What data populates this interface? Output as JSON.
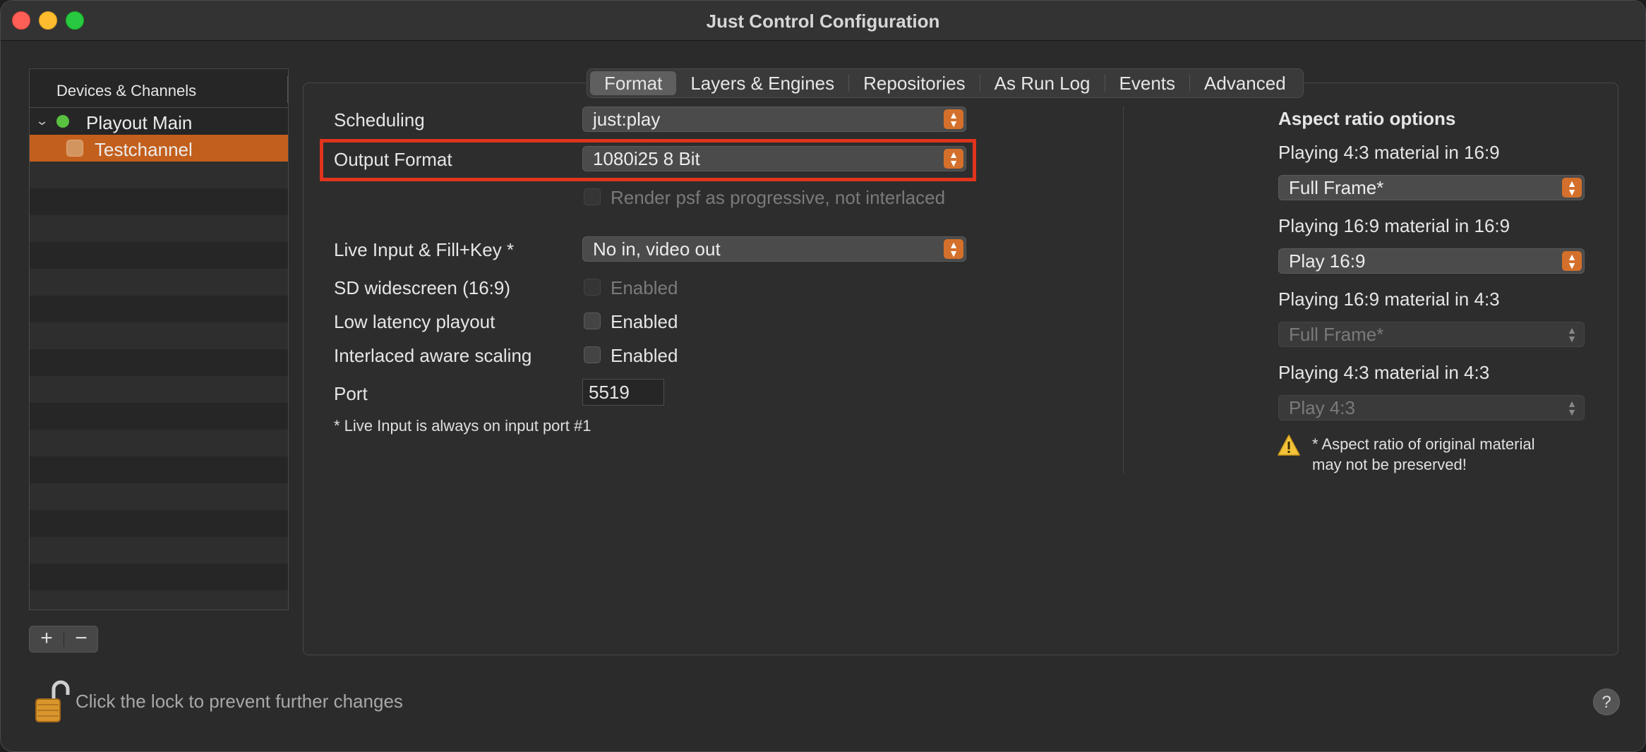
{
  "window": {
    "title": "Just Control Configuration"
  },
  "sidebar": {
    "header": "Devices & Channels",
    "device": {
      "label": "Playout Main"
    },
    "channel": {
      "label": "Testchannel"
    }
  },
  "sidebar_buttons": {
    "add": "+",
    "remove": "−"
  },
  "tabs": [
    {
      "label": "Format"
    },
    {
      "label": "Layers & Engines"
    },
    {
      "label": "Repositories"
    },
    {
      "label": "As Run Log"
    },
    {
      "label": "Events"
    },
    {
      "label": "Advanced"
    }
  ],
  "format": {
    "scheduling": {
      "label": "Scheduling",
      "value": "just:play"
    },
    "output_format": {
      "label": "Output Format",
      "value": "1080i25 8 Bit"
    },
    "render_psf": {
      "label": "Render psf as progressive, not interlaced"
    },
    "live_input": {
      "label": "Live Input & Fill+Key *",
      "value": "No in, video out"
    },
    "sd_widescreen": {
      "label": "SD widescreen (16:9)",
      "cb_label": "Enabled"
    },
    "low_latency": {
      "label": "Low latency playout",
      "cb_label": "Enabled"
    },
    "interlaced_scaling": {
      "label": "Interlaced aware scaling",
      "cb_label": "Enabled"
    },
    "port": {
      "label": "Port",
      "value": "5519"
    },
    "note": "* Live Input is always on input port #1"
  },
  "aspect": {
    "title": "Aspect ratio options",
    "opt1": {
      "label": "Playing 4:3 material in 16:9",
      "value": "Full Frame*"
    },
    "opt2": {
      "label": "Playing 16:9 material in 16:9",
      "value": "Play 16:9"
    },
    "opt3": {
      "label": "Playing 16:9 material in 4:3",
      "value": "Full Frame*"
    },
    "opt4": {
      "label": "Playing 4:3 material in 4:3",
      "value": "Play 4:3"
    },
    "warning": "* Aspect ratio of original material may not be preserved!"
  },
  "footer": {
    "lock_text": "Click the lock to prevent further changes",
    "help": "?"
  },
  "colors": {
    "accent": "#d4702b",
    "selection": "#c35f1c",
    "highlight": "#e0341c",
    "status_green": "#5ac040"
  }
}
